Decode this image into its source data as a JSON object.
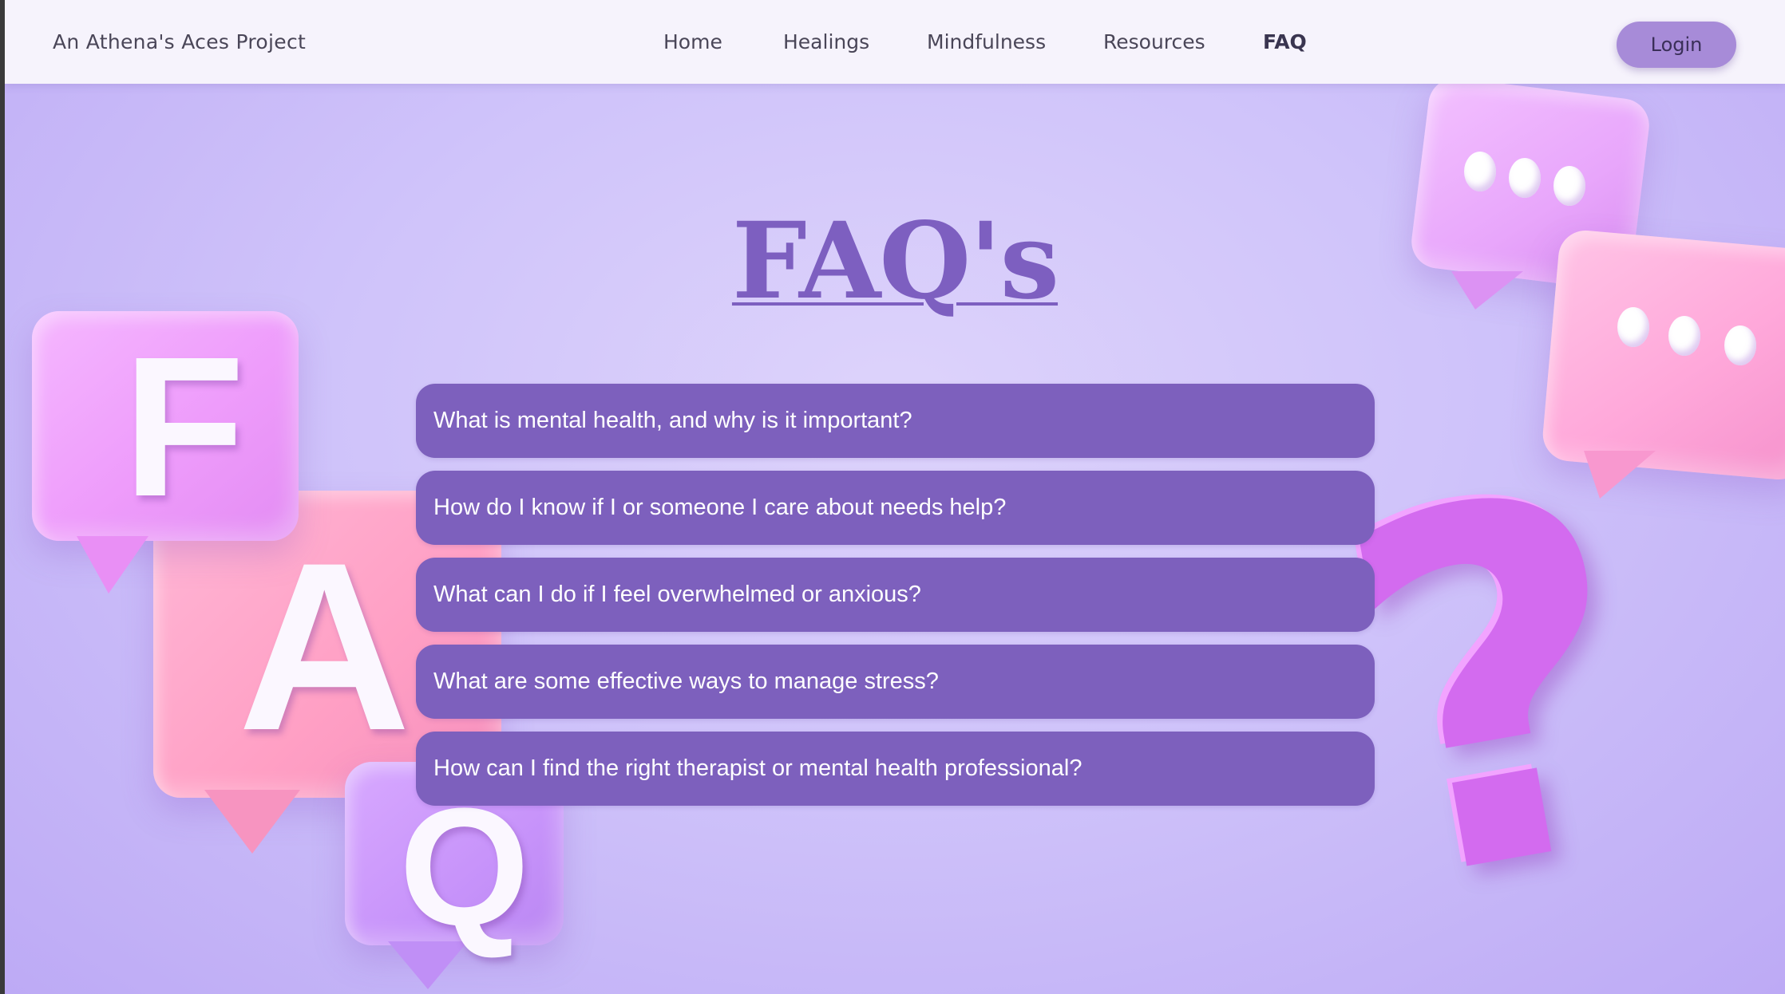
{
  "header": {
    "brand": "An Athena's Aces Project",
    "nav": [
      {
        "label": "Home",
        "active": false
      },
      {
        "label": "Healings",
        "active": false
      },
      {
        "label": "Mindfulness",
        "active": false
      },
      {
        "label": "Resources",
        "active": false
      },
      {
        "label": "FAQ",
        "active": true
      }
    ],
    "login_label": "Login"
  },
  "main": {
    "title": "FAQ's",
    "questions": [
      "What is mental health, and why is it important?",
      "How do I know if I or someone I care about needs help?",
      "What can I do if I feel overwhelmed or anxious?",
      "What are some effective ways to manage stress?",
      "How can I find the right therapist or mental health professional?"
    ]
  },
  "decor": {
    "letters": [
      "F",
      "A",
      "Q"
    ],
    "question_mark": "?"
  },
  "colors": {
    "accent": "#7d60bd",
    "login_button": "#a78bd8",
    "header_bg": "#f6f3fc",
    "page_bg": "#d4c8fa"
  }
}
